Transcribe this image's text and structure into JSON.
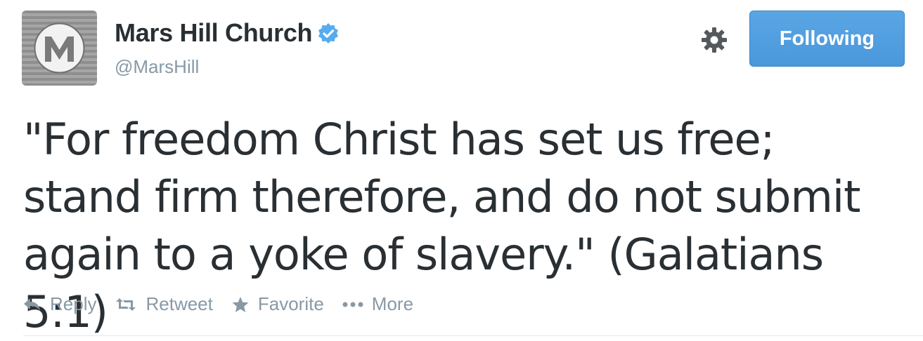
{
  "profile": {
    "name": "Mars Hill Church",
    "handle": "@MarsHill",
    "avatar_icon": "mars-hill-logo",
    "verified_icon": "verified-badge-icon"
  },
  "header": {
    "settings_icon": "gear-icon",
    "follow_label": "Following"
  },
  "tweet": {
    "text": "\"For freedom Christ has set us free; stand firm therefore, and do not submit again to a yoke of slavery.\" (Galatians 5:1)"
  },
  "actions": {
    "reply": "Reply",
    "retweet": "Retweet",
    "favorite": "Favorite",
    "more": "More"
  },
  "colors": {
    "accent": "#55acee",
    "text": "#292f33",
    "muted": "#8899a6"
  }
}
